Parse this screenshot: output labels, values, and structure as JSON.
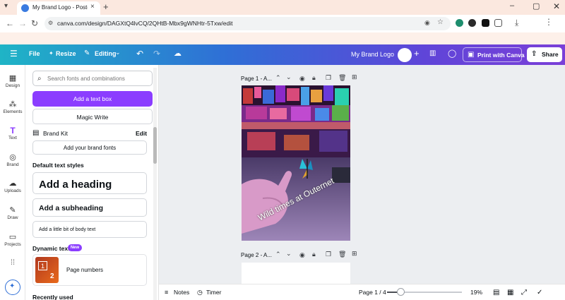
{
  "browser": {
    "tab_title": "My Brand Logo - Poster - Canva",
    "tab_close": "×",
    "new_tab": "+",
    "url": "canva.com/design/DAGXtQ4lvCQ/2QHtB-Mbx9gWNHtr-5Txw/edit",
    "window_controls": {
      "minimize": "–",
      "maximize": "▢",
      "close": "✕"
    }
  },
  "header": {
    "file_label": "File",
    "resize_label": "Resize",
    "editing_label": "Editing",
    "design_title": "My Brand Logo",
    "print_label": "Print with Canva",
    "share_label": "Share",
    "gradient_start": "#1fb4c6",
    "gradient_end": "#7a3fd8"
  },
  "rail": {
    "items": [
      {
        "label": "Design",
        "icon": "design-icon"
      },
      {
        "label": "Elements",
        "icon": "elements-icon"
      },
      {
        "label": "Text",
        "icon": "text-icon"
      },
      {
        "label": "Brand",
        "icon": "brand-icon"
      },
      {
        "label": "Uploads",
        "icon": "uploads-icon"
      },
      {
        "label": "Draw",
        "icon": "draw-icon"
      },
      {
        "label": "Projects",
        "icon": "projects-icon"
      }
    ]
  },
  "panel": {
    "search_placeholder": "Search fonts and combinations",
    "add_text_box": "Add a text box",
    "magic_write": "Magic Write",
    "brand_kit": "Brand Kit",
    "brand_kit_edit": "Edit",
    "add_brand_fonts": "Add your brand fonts",
    "default_text_styles": "Default text styles",
    "heading": "Add a heading",
    "subheading": "Add a subheading",
    "body_text": "Add a little bit of body text",
    "dynamic_text": "Dynamic text",
    "new_badge": "New",
    "page_numbers": "Page numbers",
    "page_numbers_thumb": [
      "1",
      "2"
    ],
    "recently_used": "Recently used",
    "accent_color": "#8b3dff"
  },
  "canvas": {
    "page1_label": "Page 1 - A...",
    "page2_label": "Page 2 - A...",
    "poster_caption": "Wild times at Outernet"
  },
  "bottom_bar": {
    "notes_label": "Notes",
    "timer_label": "Timer",
    "page_indicator": "Page 1 / 4",
    "zoom_label": "19%",
    "zoom_fraction": 0.19
  }
}
